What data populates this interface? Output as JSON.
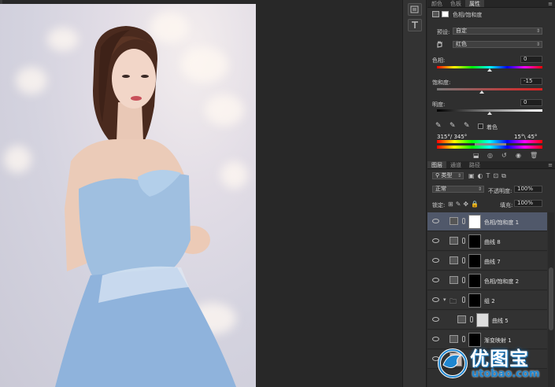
{
  "properties_panel": {
    "tabs": [
      "颜色",
      "色板",
      "属性"
    ],
    "active_tab": "属性",
    "title": "色相/饱和度",
    "preset_label": "预设:",
    "preset_value": "自定",
    "channel_value": "红色",
    "hue_label": "色相:",
    "hue_value": "0",
    "saturation_label": "饱和度:",
    "saturation_value": "-15",
    "lightness_label": "明度:",
    "lightness_value": "0",
    "colorize_label": "着色",
    "range_left": "315°/ 345°",
    "range_right": "15°\\ 45°"
  },
  "layers_panel": {
    "tabs": [
      "图层",
      "通道",
      "路径"
    ],
    "active_tab": "图层",
    "filter_label": "类型",
    "blend_mode": "正常",
    "opacity_label": "不透明度:",
    "opacity_value": "100%",
    "lock_label": "锁定:",
    "fill_label": "填充:",
    "fill_value": "100%",
    "layers": [
      {
        "name": "色相/饱和度 1",
        "selected": true
      },
      {
        "name": "曲线 8",
        "selected": false
      },
      {
        "name": "曲线 7",
        "selected": false
      },
      {
        "name": "色相/饱和度 2",
        "selected": false
      },
      {
        "name": "组 2",
        "selected": false
      },
      {
        "name": "曲线 5",
        "selected": false
      },
      {
        "name": "渐变映射 1",
        "selected": false
      },
      {
        "name": "",
        "selected": false
      }
    ]
  },
  "watermark": {
    "cn": "优图宝",
    "en": "utobao.com"
  },
  "colors": {
    "selected_layer": "#50586a",
    "panel_bg": "#2f2f2f",
    "canvas_bg": "#282828"
  }
}
